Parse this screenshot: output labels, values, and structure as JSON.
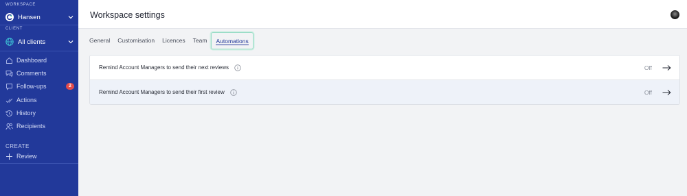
{
  "sidebar": {
    "workspace_label": "WORKSPACE",
    "workspace_name": "Hansen",
    "client_label": "CLIENT",
    "client_name": "All clients",
    "nav": [
      {
        "label": "Dashboard",
        "icon": "home-icon"
      },
      {
        "label": "Comments",
        "icon": "comments-icon"
      },
      {
        "label": "Follow-ups",
        "icon": "followups-icon",
        "badge": "2"
      },
      {
        "label": "Actions",
        "icon": "check-icon"
      },
      {
        "label": "History",
        "icon": "history-icon"
      },
      {
        "label": "Recipients",
        "icon": "users-icon"
      }
    ],
    "create_label": "CREATE",
    "create_item": "Review"
  },
  "header": {
    "title": "Workspace settings"
  },
  "tabs": [
    {
      "label": "General",
      "active": false
    },
    {
      "label": "Customisation",
      "active": false
    },
    {
      "label": "Licences",
      "active": false
    },
    {
      "label": "Team",
      "active": false
    },
    {
      "label": "Automations",
      "active": true
    }
  ],
  "automations": [
    {
      "label": "Remind Account Managers to send their next reviews",
      "status": "Off"
    },
    {
      "label": "Remind Account Managers to send their first review",
      "status": "Off"
    }
  ],
  "colors": {
    "sidebar": "#22399a",
    "accent": "#22399a",
    "badge": "#e24b4b",
    "tab_focus": "#98dcc6"
  }
}
